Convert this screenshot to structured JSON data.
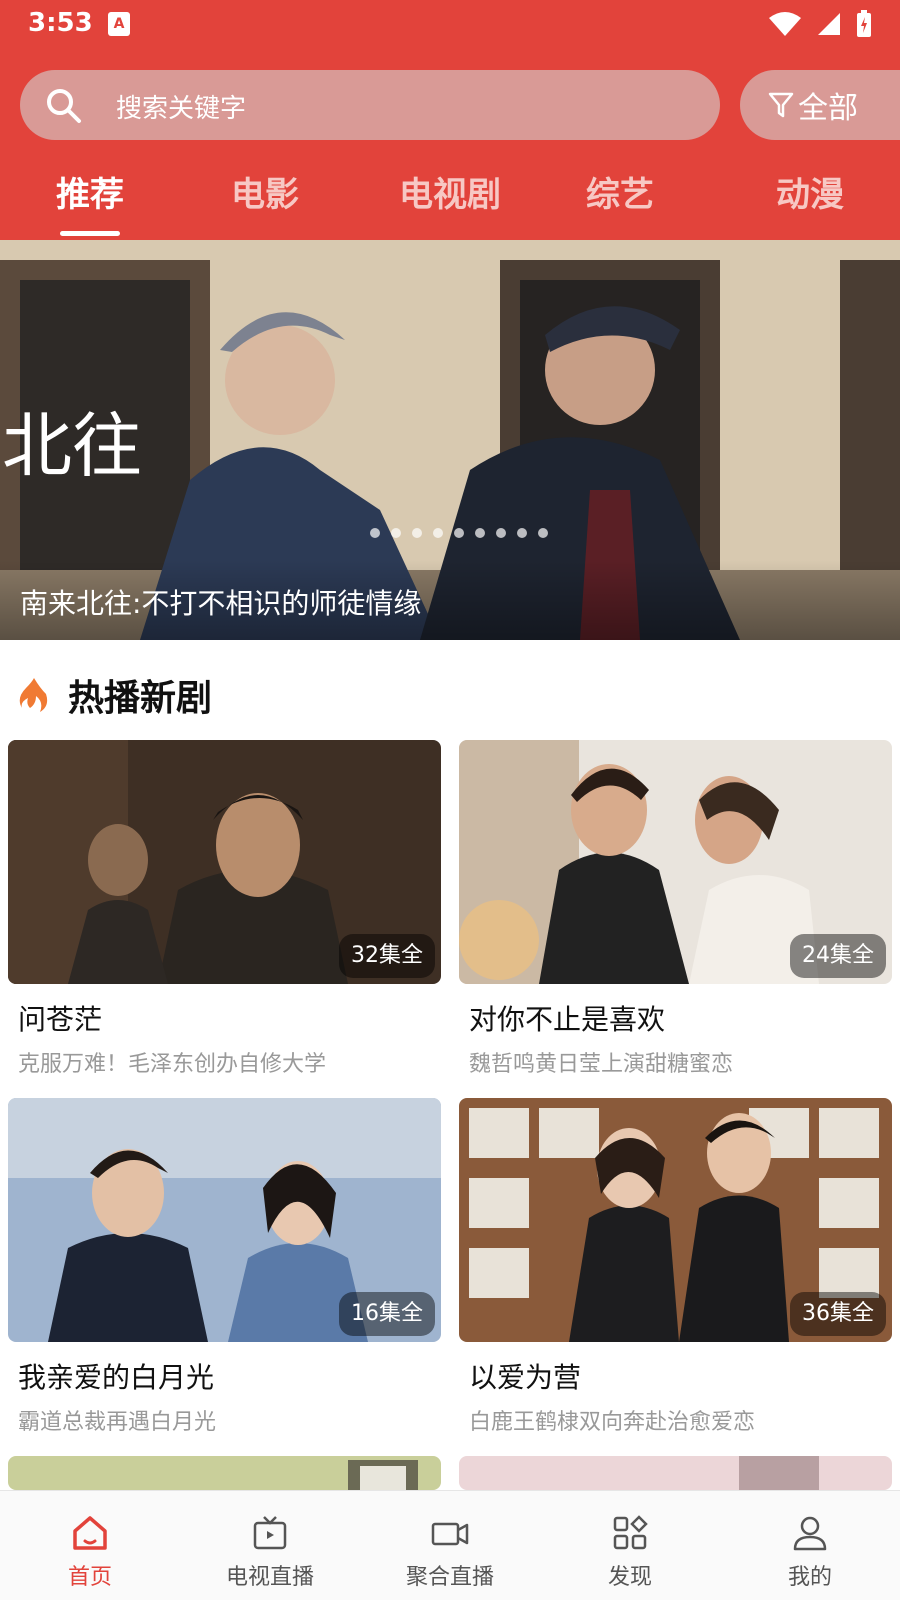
{
  "status_bar": {
    "time": "3:53",
    "notification_icon": "A"
  },
  "search": {
    "placeholder": "搜索关键字"
  },
  "filter": {
    "label": "全部"
  },
  "tabs": [
    {
      "label": "推荐"
    },
    {
      "label": "电影"
    },
    {
      "label": "电视剧"
    },
    {
      "label": "综艺"
    },
    {
      "label": "动漫"
    }
  ],
  "banner": {
    "caption": "南来北往:不打不相识的师徒情缘",
    "slide_count": 9,
    "active_slide": 0
  },
  "section": {
    "title": "热播新剧",
    "icon": "flame-icon"
  },
  "shows": [
    {
      "title": "问苍茫",
      "desc": "克服万难！毛泽东创办自修大学",
      "episodes": "32集全"
    },
    {
      "title": "对你不止是喜欢",
      "desc": "魏哲鸣黄日莹上演甜糖蜜恋",
      "episodes": "24集全"
    },
    {
      "title": "我亲爱的白月光",
      "desc": "霸道总裁再遇白月光",
      "episodes": "16集全"
    },
    {
      "title": "以爱为营",
      "desc": "白鹿王鹤棣双向奔赴治愈爱恋",
      "episodes": "36集全"
    }
  ],
  "bottom_nav": [
    {
      "label": "首页",
      "icon": "home-icon"
    },
    {
      "label": "电视直播",
      "icon": "tv-icon"
    },
    {
      "label": "聚合直播",
      "icon": "camera-icon"
    },
    {
      "label": "发现",
      "icon": "discover-icon"
    },
    {
      "label": "我的",
      "icon": "user-icon"
    }
  ],
  "colors": {
    "accent": "#e2433b",
    "search_bg": "#d99a96"
  }
}
